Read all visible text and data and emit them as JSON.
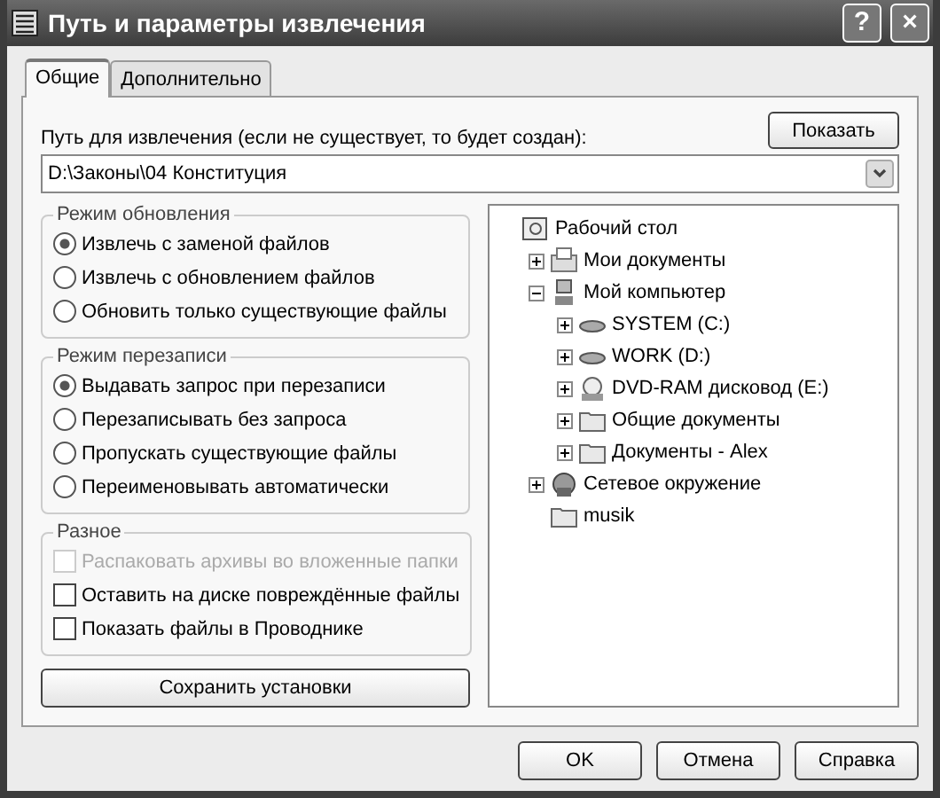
{
  "window": {
    "title": "Путь и параметры извлечения",
    "help_button": "?",
    "close_button": "×"
  },
  "tabs": [
    {
      "label": "Общие",
      "selected": true
    },
    {
      "label": "Дополнительно",
      "selected": false
    }
  ],
  "path": {
    "label": "Путь для извлечения (если не существует, то будет создан):",
    "show_button": "Показать",
    "value": "D:\\Законы\\04 Конституция"
  },
  "update_mode": {
    "title": "Режим обновления",
    "options": [
      {
        "label": "Извлечь с заменой файлов",
        "selected": true
      },
      {
        "label": "Извлечь с обновлением файлов",
        "selected": false
      },
      {
        "label": "Обновить только существующие файлы",
        "selected": false
      }
    ]
  },
  "overwrite_mode": {
    "title": "Режим перезаписи",
    "options": [
      {
        "label": "Выдавать запрос при перезаписи",
        "selected": true
      },
      {
        "label": "Перезаписывать без запроса",
        "selected": false
      },
      {
        "label": "Пропускать существующие файлы",
        "selected": false
      },
      {
        "label": "Переименовывать автоматически",
        "selected": false
      }
    ]
  },
  "misc": {
    "title": "Разное",
    "options": [
      {
        "label": "Распаковать архивы во вложенные папки",
        "checked": false,
        "disabled": true
      },
      {
        "label": "Оставить на диске повреждённые файлы",
        "checked": false,
        "disabled": false
      },
      {
        "label": "Показать файлы в Проводнике",
        "checked": false,
        "disabled": false
      }
    ]
  },
  "save_button": "Сохранить установки",
  "tree": [
    {
      "label": "Рабочий стол",
      "kind": "desktop",
      "children": [
        {
          "label": "Мои документы",
          "kind": "documents",
          "expanded": false
        },
        {
          "label": "Мой компьютер",
          "kind": "computer",
          "expanded": true,
          "children": [
            {
              "label": "SYSTEM (C:)",
              "kind": "drive",
              "expanded": false
            },
            {
              "label": "WORK (D:)",
              "kind": "drive",
              "expanded": false
            },
            {
              "label": "DVD-RAM дисковод (E:)",
              "kind": "dvd",
              "expanded": false
            },
            {
              "label": "Общие документы",
              "kind": "folder",
              "expanded": false
            },
            {
              "label": "Документы - Alex",
              "kind": "folder",
              "expanded": false
            }
          ]
        },
        {
          "label": "Сетевое окружение",
          "kind": "network",
          "expanded": false
        },
        {
          "label": "musik",
          "kind": "folder"
        }
      ]
    }
  ],
  "buttons": [
    "OK",
    "Отмена",
    "Справка"
  ]
}
